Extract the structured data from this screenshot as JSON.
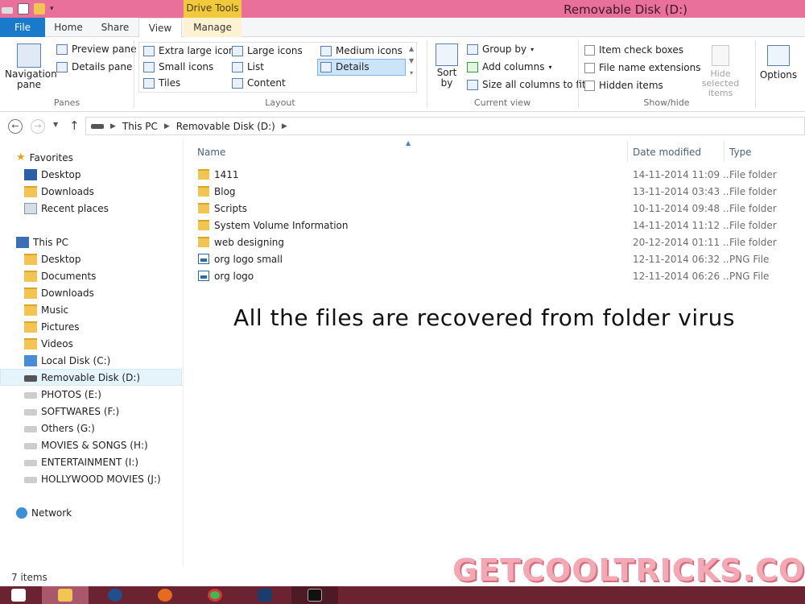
{
  "window": {
    "title": "Removable Disk (D:)",
    "context_tab": "Drive Tools"
  },
  "ribbon_tabs": {
    "file": "File",
    "home": "Home",
    "share": "Share",
    "view": "View",
    "manage": "Manage"
  },
  "ribbon": {
    "panes": {
      "navigation_pane": "Navigation pane",
      "preview_pane": "Preview pane",
      "details_pane": "Details pane",
      "label": "Panes"
    },
    "layout": {
      "extra_large_icons": "Extra large icons",
      "large_icons": "Large icons",
      "medium_icons": "Medium icons",
      "small_icons": "Small icons",
      "list": "List",
      "details": "Details",
      "tiles": "Tiles",
      "content": "Content",
      "label": "Layout",
      "selected": "Details"
    },
    "current_view": {
      "sort_by": "Sort by",
      "group_by": "Group by",
      "add_columns": "Add columns",
      "size_all_columns": "Size all columns to fit",
      "label": "Current view"
    },
    "show_hide": {
      "item_check_boxes": "Item check boxes",
      "file_name_extensions": "File name extensions",
      "hidden_items": "Hidden items",
      "hide_selected_items": "Hide selected items",
      "label": "Show/hide"
    },
    "options": "Options"
  },
  "address": {
    "crumbs": [
      "This PC",
      "Removable Disk (D:)"
    ]
  },
  "nav_pane": {
    "favorites_label": "Favorites",
    "favorites": [
      "Desktop",
      "Downloads",
      "Recent places"
    ],
    "this_pc_label": "This PC",
    "this_pc": [
      "Desktop",
      "Documents",
      "Downloads",
      "Music",
      "Pictures",
      "Videos",
      "Local Disk (C:)",
      "Removable Disk (D:)",
      "PHOTOS (E:)",
      "SOFTWARES (F:)",
      "Others (G:)",
      "MOVIES & SONGS (H:)",
      "ENTERTAINMENT (I:)",
      "HOLLYWOOD MOVIES (J:)"
    ],
    "selected": "Removable Disk (D:)",
    "network_label": "Network"
  },
  "file_list": {
    "columns": [
      "Name",
      "Date modified",
      "Type"
    ],
    "rows": [
      {
        "name": "1411",
        "date": "14-11-2014 11:09 ...",
        "type": "File folder",
        "icon": "folder-icon"
      },
      {
        "name": "Blog",
        "date": "13-11-2014 03:43 ...",
        "type": "File folder",
        "icon": "folder-icon"
      },
      {
        "name": "Scripts",
        "date": "10-11-2014 09:48 ...",
        "type": "File folder",
        "icon": "folder-icon"
      },
      {
        "name": "System Volume Information",
        "date": "14-11-2014 11:12 ...",
        "type": "File folder",
        "icon": "folder-icon"
      },
      {
        "name": "web designing",
        "date": "20-12-2014 01:11 ...",
        "type": "File folder",
        "icon": "folder-icon"
      },
      {
        "name": "org logo small",
        "date": "12-11-2014 06:32 ...",
        "type": "PNG File",
        "icon": "image-file-icon"
      },
      {
        "name": "org logo",
        "date": "12-11-2014 06:26 ...",
        "type": "PNG File",
        "icon": "image-file-icon"
      }
    ]
  },
  "overlay_caption": "All the files are recovered from folder virus",
  "status": {
    "item_count": "7 items"
  },
  "watermark": "GETCOOLTRICKS.COM",
  "taskbar": {
    "apps": [
      "start-icon",
      "file-explorer-icon",
      "media-player-icon",
      "firefox-icon",
      "chrome-icon",
      "photoshop-icon",
      "command-prompt-icon"
    ]
  },
  "colors": {
    "titlebar": "#e8709a",
    "file_tab": "#1979ca",
    "context_tab": "#f0c93c",
    "selection": "#cce4f7",
    "taskbar": "#6b2332",
    "watermark": "#f3a9b4"
  }
}
